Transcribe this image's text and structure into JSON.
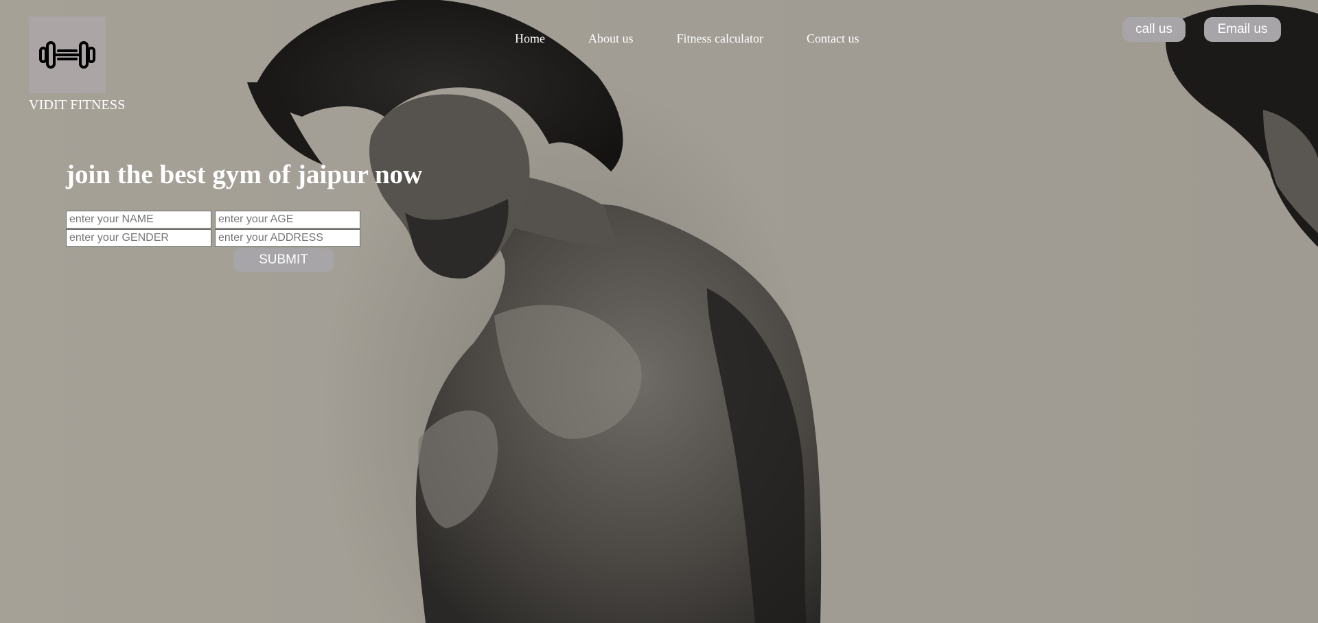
{
  "brand": {
    "name": "VIDIT FITNESS",
    "logo_icon": "dumbbell-icon"
  },
  "nav": {
    "items": [
      {
        "label": "Home"
      },
      {
        "label": "About us"
      },
      {
        "label": "Fitness calculator"
      },
      {
        "label": "Contact us"
      }
    ]
  },
  "header_actions": {
    "call_label": "call us",
    "email_label": "Email us"
  },
  "hero": {
    "headline": "join the best gym of jaipur now",
    "background_image": "grayscale portrait of a muscular man looking down, partial duplicate at right edge"
  },
  "form": {
    "name_placeholder": "enter your NAME",
    "age_placeholder": "enter your AGE",
    "gender_placeholder": "enter your GENDER",
    "address_placeholder": "enter your ADDRESS",
    "submit_label": "SUBMIT"
  },
  "colors": {
    "background": "#a39f96",
    "button": "#a7a5a8",
    "logo_box": "#aba5a6",
    "text": "#ffffff"
  }
}
